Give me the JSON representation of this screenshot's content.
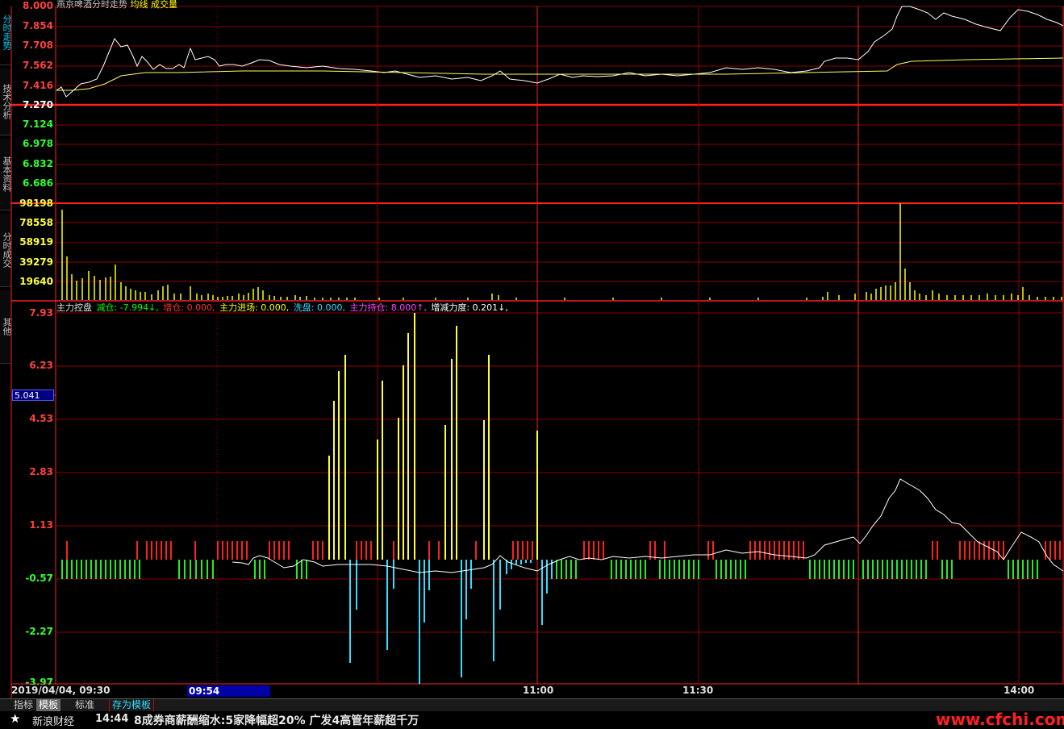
{
  "left_tabs": [
    "分时走势",
    "技术分析",
    "基本资料",
    "分时成交",
    "其他"
  ],
  "price_panel": {
    "title_parts": [
      {
        "text": "燕京啤酒分时走势",
        "color": "#c0c0c0"
      },
      {
        "text": "均线",
        "color": "#ffff00"
      },
      {
        "text": "成交量",
        "color": "#ffff00"
      }
    ],
    "upper_labels": [
      "8.000",
      "7.854",
      "7.708",
      "7.562",
      "7.416"
    ],
    "mid_label": "7.270",
    "lower_labels": [
      "7.124",
      "6.978",
      "6.832",
      "6.686"
    ]
  },
  "volume_panel": {
    "labels": [
      "98198",
      "78558",
      "58919",
      "39279",
      "19640"
    ]
  },
  "indicator_panel": {
    "name": "主力控盘",
    "items": [
      {
        "text": "减仓: -7.994↓,",
        "color": "#00ff00"
      },
      {
        "text": "增仓: 0.000,",
        "color": "#ff3030"
      },
      {
        "text": "主力进场: 0.000,",
        "color": "#ffff00"
      },
      {
        "text": "洗盘: 0.000,",
        "color": "#33ddff"
      },
      {
        "text": "主力持仓: 8.000↑,",
        "color": "#ff44ff"
      },
      {
        "text": "增减力度: 0.201↓,",
        "color": "#ffffff"
      }
    ],
    "labels": [
      "7.93",
      "6.23",
      "4.53",
      "2.83",
      "1.13",
      "-0.57",
      "-2.27",
      "-3.97"
    ],
    "cursor_value": "5.041"
  },
  "time_axis": {
    "date_time": "2019/04/04, 09:30",
    "selected_time": "09:54",
    "labels": [
      "11:00",
      "11:30",
      "14:00"
    ]
  },
  "bottom_tabs": [
    "指标",
    "模板",
    "标准",
    "存为模板"
  ],
  "ticker": {
    "source": "新浪财经",
    "time": "14:44",
    "headline": "8成券商薪酬缩水:5家降幅超20% 广发4高管年薪超千万",
    "watermark": "www.cfchi.com"
  },
  "colors": {
    "grid": "#8b0000",
    "grid_bright": "#ff2020",
    "price_line": "#ffffff",
    "avg_line": "#ffff66",
    "volume_bar": "#ffff00",
    "ind_red": "#ff2020",
    "ind_green": "#22ee22",
    "ind_yellow": "#ffff33",
    "ind_cyan": "#33ddff",
    "label_red": "#ff4040",
    "label_green": "#30ff30",
    "label_yellow": "#ffff40"
  }
}
